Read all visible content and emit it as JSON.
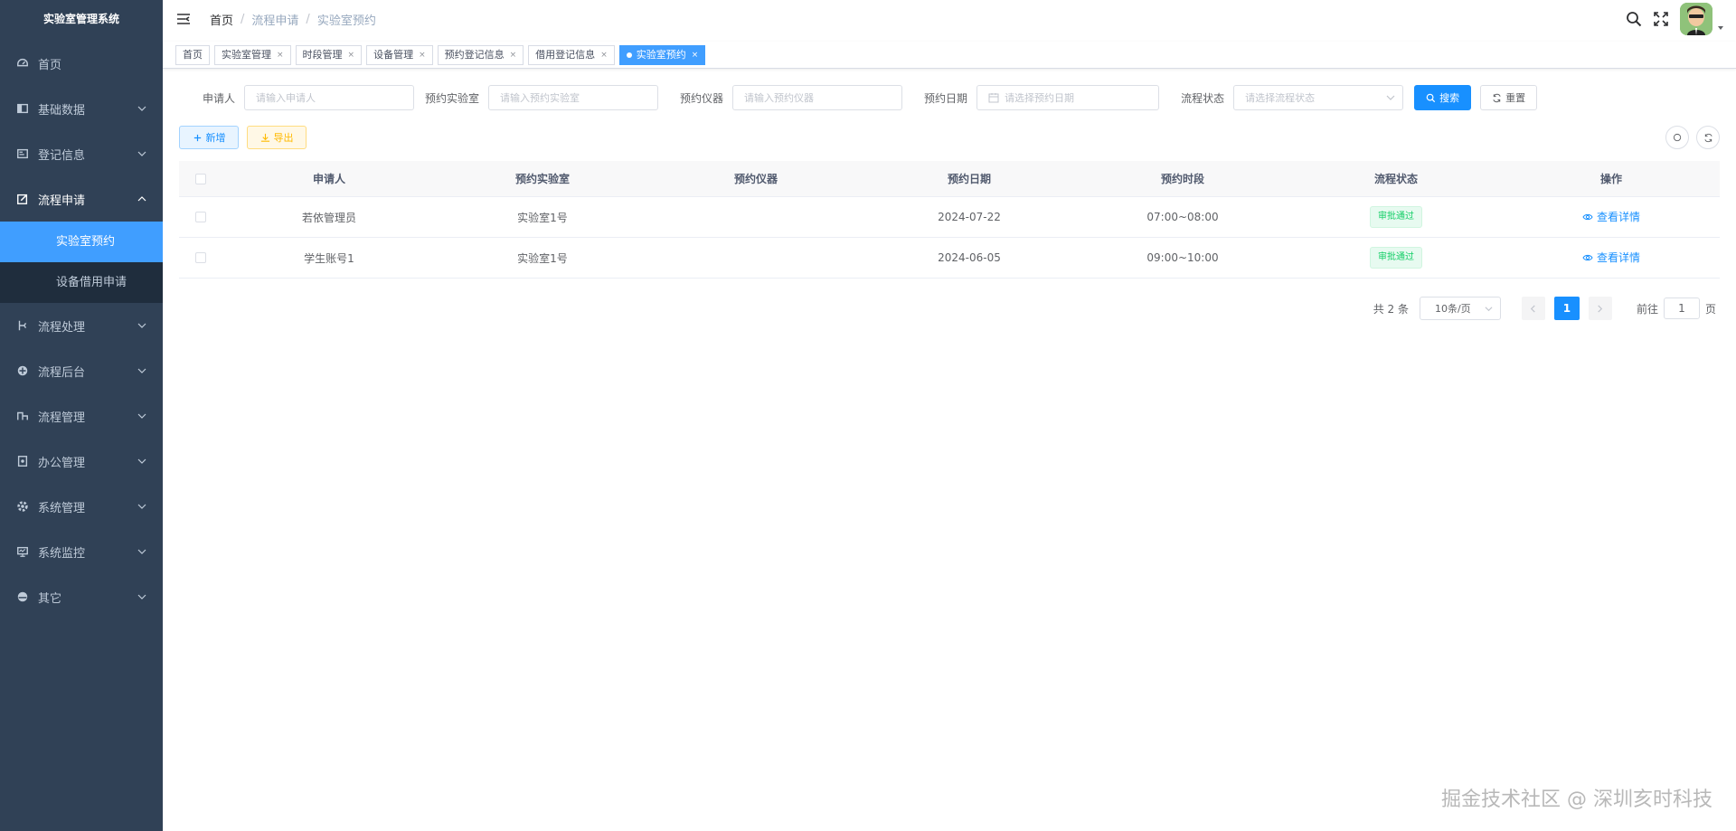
{
  "app": {
    "title": "实验室管理系统"
  },
  "sidebar": {
    "items": [
      {
        "label": "首页",
        "icon": "dashboard-icon",
        "has_children": false
      },
      {
        "label": "基础数据",
        "icon": "data-icon",
        "has_children": true
      },
      {
        "label": "登记信息",
        "icon": "register-icon",
        "has_children": true
      },
      {
        "label": "流程申请",
        "icon": "edit-icon",
        "has_children": true,
        "open": true
      },
      {
        "label": "流程处理",
        "icon": "process-icon",
        "has_children": true
      },
      {
        "label": "流程后台",
        "icon": "backend-icon",
        "has_children": true
      },
      {
        "label": "流程管理",
        "icon": "manage-icon",
        "has_children": true
      },
      {
        "label": "办公管理",
        "icon": "office-icon",
        "has_children": true
      },
      {
        "label": "系统管理",
        "icon": "system-icon",
        "has_children": true
      },
      {
        "label": "系统监控",
        "icon": "monitor-icon",
        "has_children": true
      },
      {
        "label": "其它",
        "icon": "other-icon",
        "has_children": true
      }
    ],
    "sub_items": [
      {
        "label": "实验室预约",
        "active": true
      },
      {
        "label": "设备借用申请",
        "active": false
      }
    ]
  },
  "header": {
    "breadcrumb": [
      "首页",
      "流程申请",
      "实验室预约"
    ],
    "sep": "/"
  },
  "tags": [
    {
      "label": "首页",
      "closable": false,
      "active": false
    },
    {
      "label": "实验室管理",
      "closable": true,
      "active": false
    },
    {
      "label": "时段管理",
      "closable": true,
      "active": false
    },
    {
      "label": "设备管理",
      "closable": true,
      "active": false
    },
    {
      "label": "预约登记信息",
      "closable": true,
      "active": false
    },
    {
      "label": "借用登记信息",
      "closable": true,
      "active": false
    },
    {
      "label": "实验室预约",
      "closable": true,
      "active": true
    }
  ],
  "tag_close": "×",
  "search": {
    "applicant_label": "申请人",
    "applicant_placeholder": "请输入申请人",
    "lab_label": "预约实验室",
    "lab_placeholder": "请输入预约实验室",
    "instrument_label": "预约仪器",
    "instrument_placeholder": "请输入预约仪器",
    "date_label": "预约日期",
    "date_placeholder": "请选择预约日期",
    "status_label": "流程状态",
    "status_placeholder": "请选择流程状态",
    "search_btn": "搜索",
    "reset_btn": "重置"
  },
  "toolbar": {
    "add_btn": "新增",
    "export_btn": "导出"
  },
  "table": {
    "headers": [
      "申请人",
      "预约实验室",
      "预约仪器",
      "预约日期",
      "预约时段",
      "流程状态",
      "操作"
    ],
    "rows": [
      {
        "applicant": "若依管理员",
        "lab": "实验室1号",
        "instrument": "",
        "date": "2024-07-22",
        "slot": "07:00~08:00",
        "status": "审批通过",
        "action": "查看详情"
      },
      {
        "applicant": "学生账号1",
        "lab": "实验室1号",
        "instrument": "",
        "date": "2024-06-05",
        "slot": "09:00~10:00",
        "status": "审批通过",
        "action": "查看详情"
      }
    ]
  },
  "pagination": {
    "total": "共 2 条",
    "page_size": "10条/页",
    "current_page": "1",
    "goto_label": "前往",
    "goto_value": "1",
    "goto_suffix": "页"
  },
  "watermark": "掘金技术社区 @ 深圳亥时科技",
  "colors": {
    "sidebar_bg": "#304156",
    "submenu_bg": "#1f2d3d",
    "primary": "#1890ff",
    "success": "#13ce66",
    "warning": "#ffba00"
  }
}
